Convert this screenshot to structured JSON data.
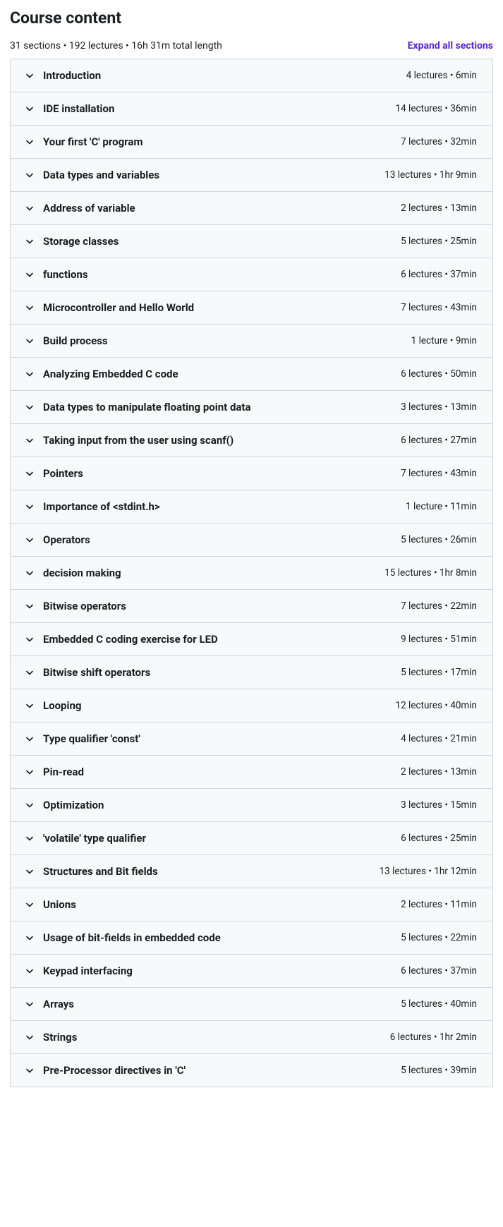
{
  "heading": "Course content",
  "summary": "31 sections • 192 lectures • 16h 31m total length",
  "expand_label": "Expand all sections",
  "sections": [
    {
      "title": "Introduction",
      "meta": "4 lectures • 6min"
    },
    {
      "title": "IDE installation",
      "meta": "14 lectures • 36min"
    },
    {
      "title": "Your first 'C' program",
      "meta": "7 lectures • 32min"
    },
    {
      "title": "Data types and variables",
      "meta": "13 lectures • 1hr 9min"
    },
    {
      "title": "Address of variable",
      "meta": "2 lectures • 13min"
    },
    {
      "title": "Storage classes",
      "meta": "5 lectures • 25min"
    },
    {
      "title": "functions",
      "meta": "6 lectures • 37min"
    },
    {
      "title": "Microcontroller and Hello World",
      "meta": "7 lectures • 43min"
    },
    {
      "title": "Build process",
      "meta": "1 lecture • 9min"
    },
    {
      "title": "Analyzing Embedded C code",
      "meta": "6 lectures • 50min"
    },
    {
      "title": "Data types to manipulate floating point data",
      "meta": "3 lectures • 13min"
    },
    {
      "title": "Taking input from the user using scanf()",
      "meta": "6 lectures • 27min"
    },
    {
      "title": "Pointers",
      "meta": "7 lectures • 43min"
    },
    {
      "title": "Importance of <stdint.h>",
      "meta": "1 lecture • 11min"
    },
    {
      "title": "Operators",
      "meta": "5 lectures • 26min"
    },
    {
      "title": "decision making",
      "meta": "15 lectures • 1hr 8min"
    },
    {
      "title": "Bitwise operators",
      "meta": "7 lectures • 22min"
    },
    {
      "title": "Embedded C coding exercise for LED",
      "meta": "9 lectures • 51min"
    },
    {
      "title": "Bitwise shift operators",
      "meta": "5 lectures • 17min"
    },
    {
      "title": "Looping",
      "meta": "12 lectures • 40min"
    },
    {
      "title": "Type qualifier 'const'",
      "meta": "4 lectures • 21min"
    },
    {
      "title": "Pin-read",
      "meta": "2 lectures • 13min"
    },
    {
      "title": "Optimization",
      "meta": "3 lectures • 15min"
    },
    {
      "title": "'volatile' type qualifier",
      "meta": "6 lectures • 25min"
    },
    {
      "title": "Structures and Bit fields",
      "meta": "13 lectures • 1hr 12min"
    },
    {
      "title": "Unions",
      "meta": "2 lectures • 11min"
    },
    {
      "title": "Usage of bit-fields in embedded code",
      "meta": "5 lectures • 22min"
    },
    {
      "title": "Keypad interfacing",
      "meta": "6 lectures • 37min"
    },
    {
      "title": "Arrays",
      "meta": "5 lectures • 40min"
    },
    {
      "title": "Strings",
      "meta": "6 lectures • 1hr 2min"
    },
    {
      "title": "Pre-Processor directives in 'C'",
      "meta": "5 lectures • 39min"
    }
  ]
}
